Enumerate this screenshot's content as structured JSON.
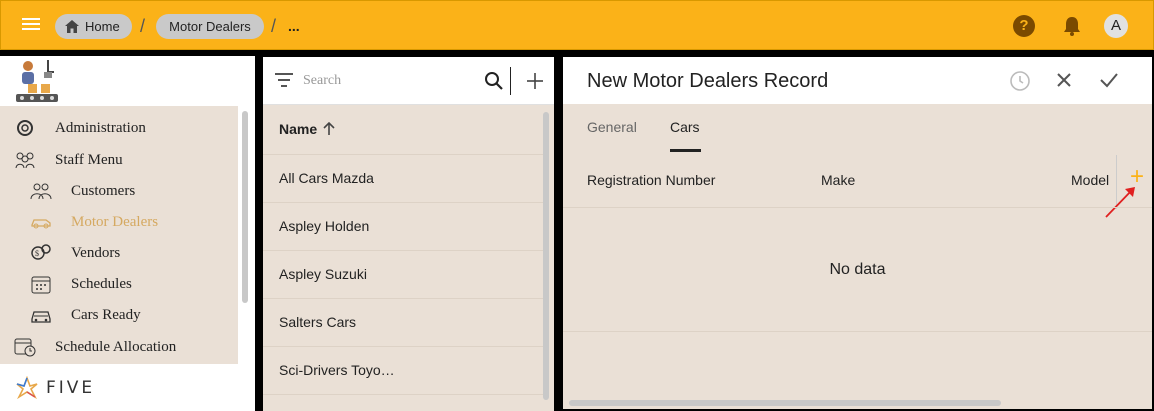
{
  "topbar": {
    "breadcrumbs": [
      "Home",
      "Motor Dealers"
    ],
    "ellipsis": "...",
    "help_label": "?",
    "avatar_label": "A",
    "accent": "#fbb218"
  },
  "sidebar": {
    "items": [
      {
        "label": "Administration",
        "icon": "gear-icon",
        "level": 0
      },
      {
        "label": "Staff Menu",
        "icon": "people-icon",
        "level": 0
      },
      {
        "label": "Customers",
        "icon": "customers-icon",
        "level": 1
      },
      {
        "label": "Motor Dealers",
        "icon": "car-icon",
        "level": 1,
        "active": true
      },
      {
        "label": "Vendors",
        "icon": "vendors-icon",
        "level": 1
      },
      {
        "label": "Schedules",
        "icon": "calendar-icon",
        "level": 1
      },
      {
        "label": "Cars Ready",
        "icon": "car-ready-icon",
        "level": 1
      },
      {
        "label": "Schedule Allocation",
        "icon": "calendar-clock-icon",
        "level": 0
      }
    ],
    "brand": "FIVE"
  },
  "list": {
    "search_placeholder": "Search",
    "column_header": "Name",
    "rows": [
      "All Cars Mazda",
      "Aspley Holden",
      "Aspley Suzuki",
      "Salters Cars",
      "Sci-Drivers Toyo…"
    ]
  },
  "form": {
    "title": "New Motor Dealers Record",
    "tabs": [
      "General",
      "Cars"
    ],
    "active_tab": "Cars",
    "columns": [
      "Registration Number",
      "Make",
      "Model"
    ],
    "empty_text": "No data",
    "add_label": "+"
  }
}
